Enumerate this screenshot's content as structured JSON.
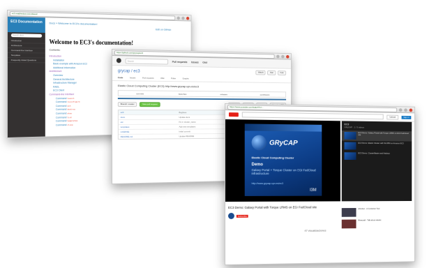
{
  "window1": {
    "url": "ec3.readthedocs.io/en/latest/",
    "sidebar": {
      "project": "EC3 Documentation",
      "search_placeholder": "Search docs",
      "items": [
        "Introduction",
        "Architecture",
        "Command-line Interface",
        "Templates",
        "Frequently Asked Questions"
      ]
    },
    "breadcrumb": "Docs » Welcome to EC3's documentation!",
    "edit_link": "Edit on GitHub",
    "title": "Welcome to EC3's documentation!",
    "contents_label": "Contents:",
    "toc": [
      {
        "level": 1,
        "text": "Introduction"
      },
      {
        "level": 2,
        "text": "Installation"
      },
      {
        "level": 2,
        "text": "Basic example with Amazon EC2"
      },
      {
        "level": 2,
        "text": "Additional information"
      },
      {
        "level": 1,
        "text": "Architecture"
      },
      {
        "level": 2,
        "text": "Overview"
      },
      {
        "level": 2,
        "text": "General Architecture"
      },
      {
        "level": 2,
        "text": "Infrastructure Manager"
      },
      {
        "level": 2,
        "text": "RADL"
      },
      {
        "level": 2,
        "text": "EC3 Client"
      },
      {
        "level": 1,
        "text": "Command-line Interface"
      },
      {
        "level": 3,
        "text": "Command",
        "code": "launch"
      },
      {
        "level": 3,
        "text": "Command",
        "code": "reconfigure"
      },
      {
        "level": 3,
        "text": "Command",
        "code": "ssh"
      },
      {
        "level": 3,
        "text": "Command",
        "code": "destroy"
      },
      {
        "level": 3,
        "text": "Command",
        "code": "show"
      },
      {
        "level": 3,
        "text": "Command",
        "code": "list"
      },
      {
        "level": 3,
        "text": "Command",
        "code": "templates"
      },
      {
        "level": 3,
        "text": "Command",
        "code": "clone"
      }
    ]
  },
  "window2": {
    "url": "https://github.com/grycap/ec3",
    "header": {
      "search_placeholder": "Search",
      "links": [
        "Pull requests",
        "Issues",
        "Gist"
      ]
    },
    "repo_title": "grycap / ec3",
    "repo_tabs": [
      "Code",
      "Issues",
      "Pull requests",
      "Wiki",
      "Pulse",
      "Graphs"
    ],
    "watch": "Watch",
    "star": "Star",
    "fork": "Fork",
    "description": "Elastic Cloud Computing Cluster (EC3) http://www.grycap.upv.es/ec3",
    "stats": [
      "commits",
      "branches",
      "releases",
      "contributors"
    ],
    "branch_label": "Branch: master",
    "new_pr": "New pull request",
    "clone_btns": [
      "New file",
      "Find file",
      "HTTPS",
      "Download ZIP"
    ],
    "files": [
      {
        "name": "ec3",
        "msg": "Bugfixes",
        "age": ""
      },
      {
        "name": "docs",
        "msg": "Update docs",
        "age": ""
      },
      {
        "name": "etc",
        "msg": "Fix in cluster_name",
        "age": ""
      },
      {
        "name": "templates",
        "msg": "Add new templates",
        "age": ""
      },
      {
        "name": "LICENSE",
        "msg": "Initial commit",
        "age": ""
      },
      {
        "name": "README.md",
        "msg": "Update README",
        "age": ""
      }
    ]
  },
  "window3": {
    "url": "https://www.youtube.com/watch?v=...",
    "upload_label": "Upload",
    "signin_label": "Sign in",
    "slide": {
      "brand": "GRyCAP",
      "ec3": "Elastic Cloud Computing Cluster",
      "demo": "Demo",
      "subtitle": "Galaxy Portal + Torque Cluster on EGI FedCloud infrastructure",
      "url": "http://www.grycap.upv.es/ec3",
      "logo": "I3M"
    },
    "video_title": "EC3 Demo: Galaxy Portal with Torque LRMS on EGI FedCloud site",
    "subscribe": "Subscribe",
    "views": "47 visualizaciones",
    "playlist": {
      "title": "EC3",
      "sub": "GRyCAP · 1 / 3 videos",
      "items": [
        "EC3 Demo: Galaxy Portal with Torque LRMS on EGI FedCloud site",
        "EC3 Demo: Elastic Cluster with SLURM on Amazon EC2",
        "EC3 Demo: ClusterMaster and Hadoop"
      ]
    },
    "related": [
      "uDocker - A Container Tool",
      "Minecraft - Talk about elastic"
    ]
  }
}
